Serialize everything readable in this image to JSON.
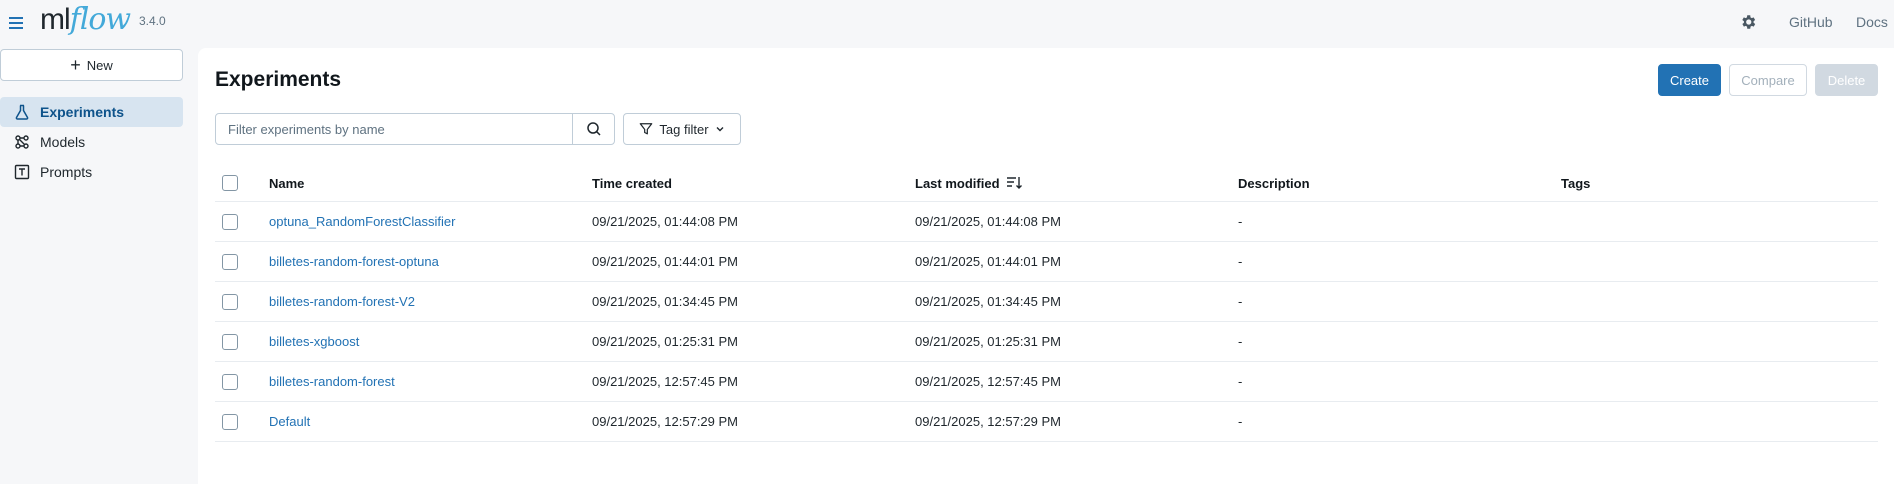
{
  "header": {
    "logo_ml": "ml",
    "logo_flow": "flow",
    "version": "3.4.0",
    "links": [
      "GitHub",
      "Docs"
    ]
  },
  "sidebar": {
    "new_label": "New",
    "items": [
      {
        "label": "Experiments",
        "icon": "beaker-icon",
        "active": true
      },
      {
        "label": "Models",
        "icon": "models-icon",
        "active": false
      },
      {
        "label": "Prompts",
        "icon": "prompt-icon",
        "active": false
      }
    ]
  },
  "main": {
    "title": "Experiments",
    "buttons": {
      "create": "Create",
      "compare": "Compare",
      "delete": "Delete"
    },
    "search": {
      "placeholder": "Filter experiments by name",
      "value": ""
    },
    "tag_filter": "Tag filter",
    "table": {
      "columns": [
        "Name",
        "Time created",
        "Last modified",
        "Description",
        "Tags"
      ],
      "rows": [
        {
          "name": "optuna_RandomForestClassifier",
          "created": "09/21/2025, 01:44:08 PM",
          "modified": "09/21/2025, 01:44:08 PM",
          "description": "-",
          "tags": ""
        },
        {
          "name": "billetes-random-forest-optuna",
          "created": "09/21/2025, 01:44:01 PM",
          "modified": "09/21/2025, 01:44:01 PM",
          "description": "-",
          "tags": ""
        },
        {
          "name": "billetes-random-forest-V2",
          "created": "09/21/2025, 01:34:45 PM",
          "modified": "09/21/2025, 01:34:45 PM",
          "description": "-",
          "tags": ""
        },
        {
          "name": "billetes-xgboost",
          "created": "09/21/2025, 01:25:31 PM",
          "modified": "09/21/2025, 01:25:31 PM",
          "description": "-",
          "tags": ""
        },
        {
          "name": "billetes-random-forest",
          "created": "09/21/2025, 12:57:45 PM",
          "modified": "09/21/2025, 12:57:45 PM",
          "description": "-",
          "tags": ""
        },
        {
          "name": "Default",
          "created": "09/21/2025, 12:57:29 PM",
          "modified": "09/21/2025, 12:57:29 PM",
          "description": "-",
          "tags": ""
        }
      ]
    }
  },
  "colors": {
    "accent": "#2272b4",
    "active_bg": "#d7e4f0",
    "logo_flow": "#43a9d9"
  }
}
